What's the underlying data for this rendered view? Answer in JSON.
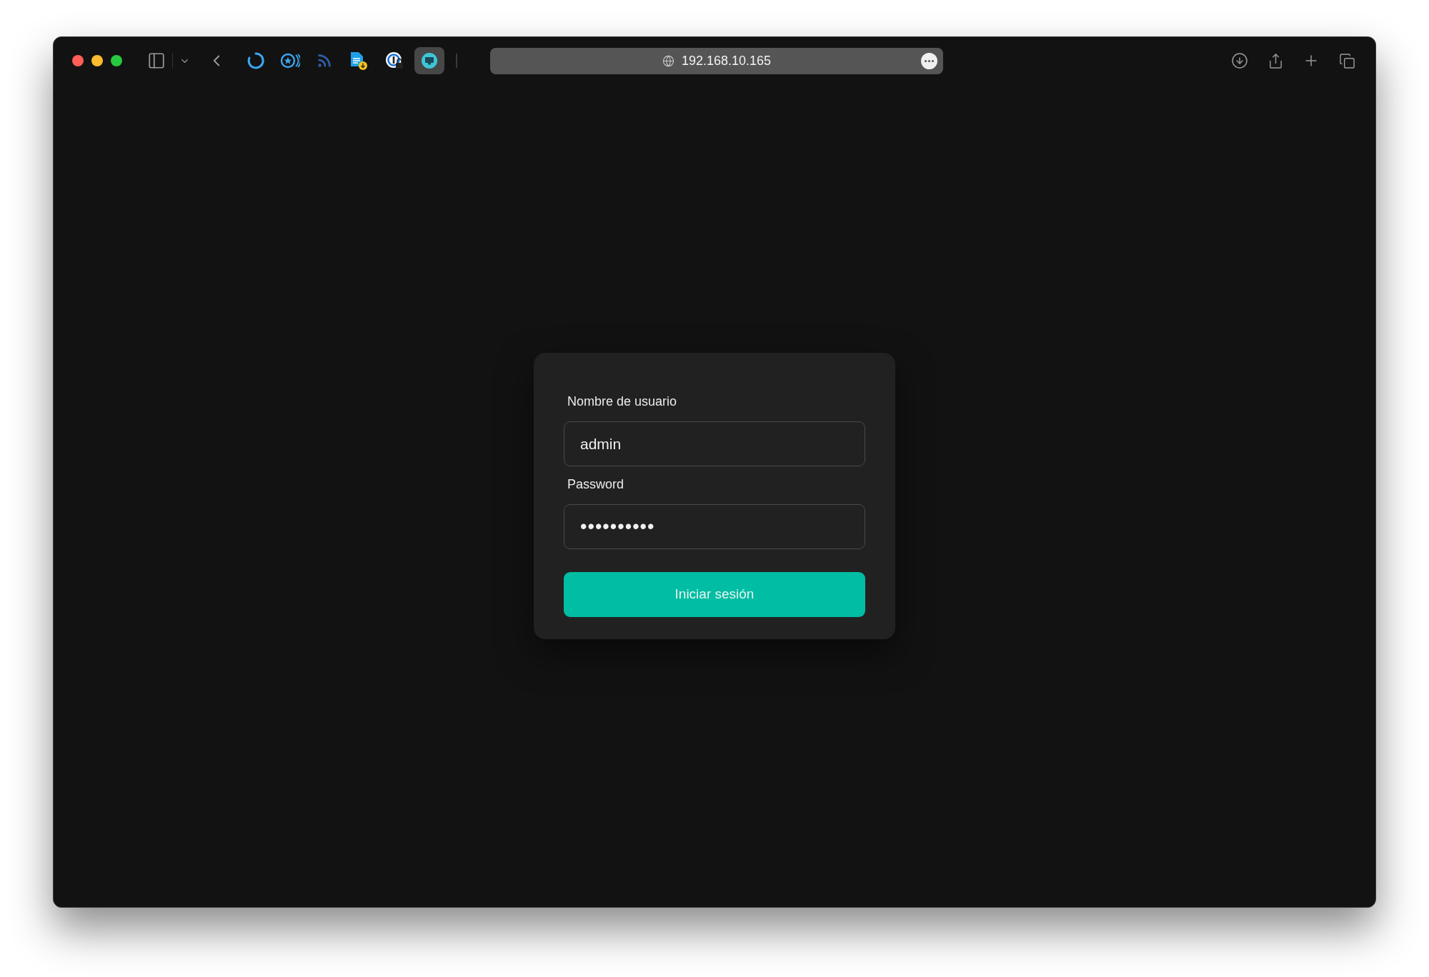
{
  "browser": {
    "address": "192.168.10.165"
  },
  "login": {
    "fields": [
      {
        "label": "Nombre de usuario",
        "value": "admin",
        "kind": "text"
      },
      {
        "label": "Password",
        "value": "••••••••••",
        "kind": "password"
      }
    ],
    "submit": "Iniciar sesión"
  }
}
